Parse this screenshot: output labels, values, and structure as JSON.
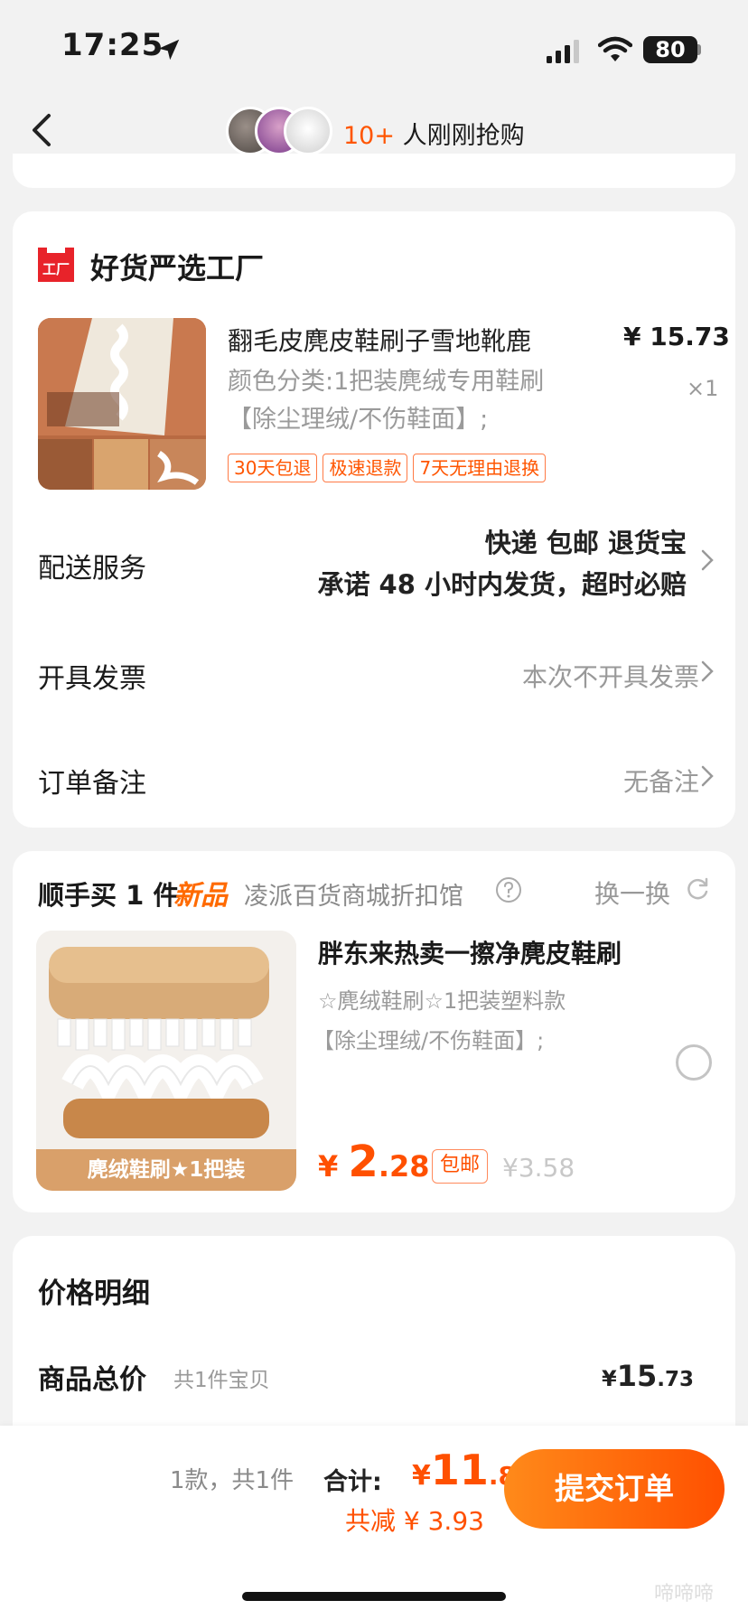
{
  "status_bar": {
    "time": "17:25",
    "battery": "80"
  },
  "header": {
    "buyers_count": "10+",
    "buyers_text": " 人刚刚抢购"
  },
  "shop": {
    "logo_text": "工厂",
    "name": "好货严选工厂"
  },
  "product": {
    "title": "翻毛皮麂皮鞋刷子雪地靴鹿",
    "price": "¥ 15.73",
    "spec": "颜色分类:1把装麂绒专用鞋刷【除尘理绒/不伤鞋面】;",
    "quantity": "×1",
    "tags": [
      "30天包退",
      "极速退款",
      "7天无理由退换"
    ]
  },
  "delivery": {
    "label": "配送服务",
    "line1": "快递 包邮 退货宝",
    "line2": "承诺 48 小时内发货，超时必赔"
  },
  "invoice": {
    "label": "开具发票",
    "value": "本次不开具发票"
  },
  "note": {
    "label": "订单备注",
    "value": "无备注"
  },
  "addon": {
    "title": "顺手买 1 件",
    "new_badge": "新品",
    "shop": "凌派百货商城折扣馆",
    "swap_label": "换一换",
    "image_label": "麂绒鞋刷★1把装",
    "name": "胖东来热卖一擦净麂皮鞋刷",
    "spec1": "☆麂绒鞋刷☆1把装塑料款",
    "spec2": "【除尘理绒/不伤鞋面】;",
    "price_currency": "¥ ",
    "price_int": "2",
    "price_dec": ".28",
    "free_shipping": "包邮",
    "original_price": "¥3.58"
  },
  "price_detail": {
    "title": "价格明细",
    "goods_total_label": "商品总价",
    "goods_count": "共1件宝贝",
    "goods_currency": "¥",
    "goods_int": "15",
    "goods_dec": ".73"
  },
  "bottom": {
    "count": "1款，共1件",
    "total_label": "合计:",
    "total_currency": "¥",
    "total_int": "11",
    "total_dec": ".80",
    "saving": "共减 ¥ 3.93",
    "submit": "提交订单"
  },
  "watermark": "啼啼啼",
  "colors": {
    "accent": "#ff5000",
    "background": "#f2f2f2",
    "muted": "#999999"
  }
}
